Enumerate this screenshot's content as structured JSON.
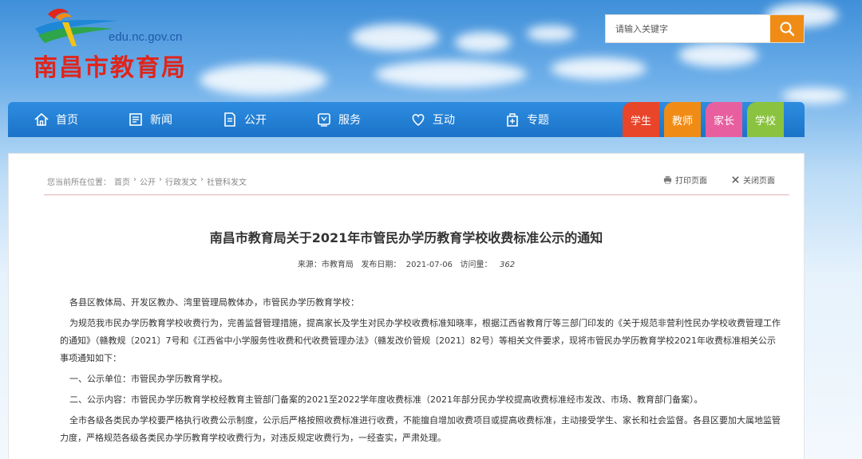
{
  "header": {
    "domain": "edu.nc.gov.cn",
    "site_title": "南昌市教育局",
    "search_placeholder": "请输入关键字"
  },
  "nav": {
    "items": [
      {
        "label": "首页",
        "icon": "home-icon"
      },
      {
        "label": "新闻",
        "icon": "news-icon"
      },
      {
        "label": "公开",
        "icon": "document-icon"
      },
      {
        "label": "服务",
        "icon": "service-icon"
      },
      {
        "label": "互动",
        "icon": "heart-icon"
      },
      {
        "label": "专题",
        "icon": "topic-icon"
      }
    ],
    "roles": [
      {
        "label": "学生",
        "color": "#e8452a"
      },
      {
        "label": "教师",
        "color": "#f08c16"
      },
      {
        "label": "家长",
        "color": "#e85fa0"
      },
      {
        "label": "学校",
        "color": "#8ac33f"
      }
    ]
  },
  "breadcrumb": {
    "prefix": "您当前所在位置：",
    "items": [
      "首页",
      "公开",
      "行政发文",
      "社管科发文"
    ],
    "separator": "›"
  },
  "tools": {
    "print": "打印页面",
    "close": "关闭页面"
  },
  "article": {
    "title": "南昌市教育局关于2021年市管民办学历教育学校收费标准公示的通知",
    "source_label": "来源：",
    "source": "市教育局",
    "date_label": "发布日期：",
    "date": "2021-07-06",
    "views_label": "访问量：",
    "views": "362",
    "paragraphs": [
      "各县区教体局、开发区教办、湾里管理局教体办，市管民办学历教育学校：",
      "为规范我市民办学历教育学校收费行为，完善监督管理措施，提高家长及学生对民办学校收费标准知晓率，根据江西省教育厅等三部门印发的《关于规范非营利性民办学校收费管理工作的通知》（赣教规〔2021〕7号和《江西省中小学服务性收费和代收费管理办法》（赣发改价管规〔2021〕82号）等相关文件要求，现将市管民办学历教育学校2021年收费标准相关公示事项通知如下：",
      "一、公示单位：市管民办学历教育学校。",
      "二、公示内容：市管民办学历教育学校经教育主管部门备案的2021至2022学年度收费标准（2021年部分民办学校提高收费标准经市发改、市场、教育部门备案）。",
      "全市各级各类民办学校要严格执行收费公示制度，公示后严格按照收费标准进行收费，不能擅自增加收费项目或提高收费标准，主动接受学生、家长和社会监督。各县区要加大属地监管力度，严格规范各级各类民办学历教育学校收费行为，对违反规定收费行为，一经查实，严肃处理。"
    ]
  }
}
